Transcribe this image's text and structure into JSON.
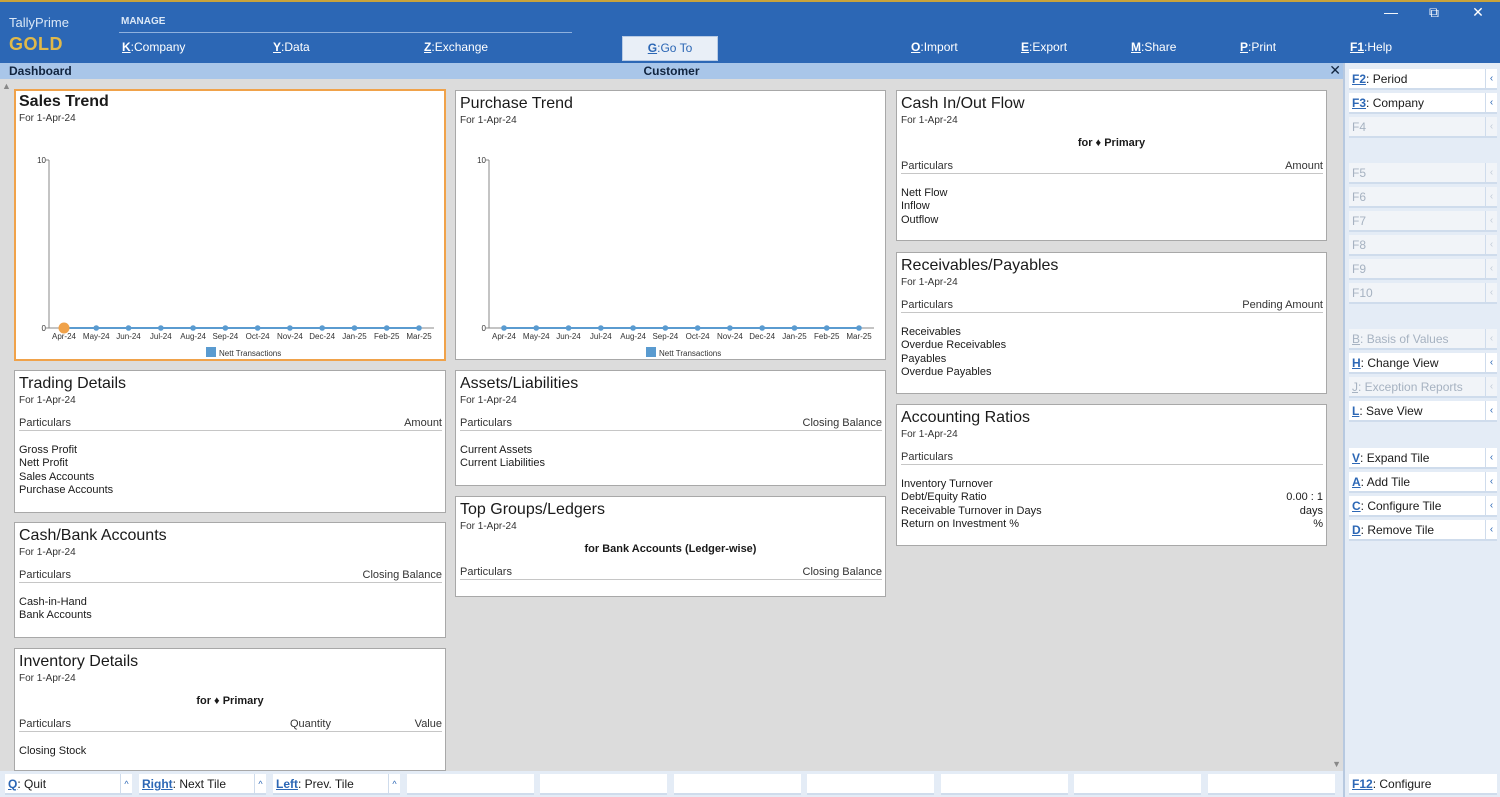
{
  "brand": {
    "name": "TallyPrime",
    "edition": "GOLD"
  },
  "menu": {
    "section": "MANAGE",
    "items": [
      {
        "key": "K",
        "label": "Company"
      },
      {
        "key": "Y",
        "label": "Data"
      },
      {
        "key": "Z",
        "label": "Exchange"
      },
      {
        "key": "G",
        "label": "Go To"
      },
      {
        "key": "O",
        "label": "Import"
      },
      {
        "key": "E",
        "label": "Export"
      },
      {
        "key": "M",
        "label": "Share"
      },
      {
        "key": "P",
        "label": "Print"
      },
      {
        "key": "F1",
        "label": "Help"
      }
    ]
  },
  "window_controls": {
    "minimize": "—",
    "restore": "⧉",
    "close": "✕"
  },
  "subheader": {
    "left": "Dashboard",
    "center": "Customer",
    "close": "✕"
  },
  "months": [
    "Apr-24",
    "May-24",
    "Jun-24",
    "Jul-24",
    "Aug-24",
    "Sep-24",
    "Oct-24",
    "Nov-24",
    "Dec-24",
    "Jan-25",
    "Feb-25",
    "Mar-25"
  ],
  "chart_data": [
    {
      "type": "line",
      "title": "Sales Trend",
      "subtitle": "For 1-Apr-24",
      "x": [
        "Apr-24",
        "May-24",
        "Jun-24",
        "Jul-24",
        "Aug-24",
        "Sep-24",
        "Oct-24",
        "Nov-24",
        "Dec-24",
        "Jan-25",
        "Feb-25",
        "Mar-25"
      ],
      "series": [
        {
          "name": "Nett Transactions",
          "values": [
            0,
            0,
            0,
            0,
            0,
            0,
            0,
            0,
            0,
            0,
            0,
            0
          ]
        }
      ],
      "ylim": [
        0,
        10
      ],
      "yticks": [
        "0",
        "10"
      ],
      "legend": "bottom",
      "highlight_index": 0,
      "colors": {
        "line": "#5a9bd0",
        "highlight": "#f0a24a"
      }
    },
    {
      "type": "line",
      "title": "Purchase Trend",
      "subtitle": "For 1-Apr-24",
      "x": [
        "Apr-24",
        "May-24",
        "Jun-24",
        "Jul-24",
        "Aug-24",
        "Sep-24",
        "Oct-24",
        "Nov-24",
        "Dec-24",
        "Jan-25",
        "Feb-25",
        "Mar-25"
      ],
      "series": [
        {
          "name": "Nett Transactions",
          "values": [
            0,
            0,
            0,
            0,
            0,
            0,
            0,
            0,
            0,
            0,
            0,
            0
          ]
        }
      ],
      "ylim": [
        0,
        10
      ],
      "yticks": [
        "0",
        "10"
      ],
      "legend": "bottom",
      "colors": {
        "line": "#5a9bd0"
      }
    }
  ],
  "tiles": {
    "cashflow": {
      "title": "Cash In/Out Flow",
      "sub": "For 1-Apr-24",
      "for": "for ♦ Primary",
      "col1": "Particulars",
      "col2": "Amount",
      "rows": [
        "Nett Flow",
        "Inflow",
        "Outflow"
      ]
    },
    "recpay": {
      "title": "Receivables/Payables",
      "sub": "For 1-Apr-24",
      "col1": "Particulars",
      "col2": "Pending Amount",
      "rows": [
        "Receivables",
        "Overdue Receivables",
        "Payables",
        "Overdue Payables"
      ]
    },
    "ratios": {
      "title": "Accounting Ratios",
      "sub": "For 1-Apr-24",
      "col1": "Particulars",
      "rows": [
        {
          "label": "Inventory Turnover",
          "value": ""
        },
        {
          "label": "Debt/Equity Ratio",
          "value": "0.00 : 1"
        },
        {
          "label": "Receivable Turnover in Days",
          "value": "days"
        },
        {
          "label": "Return on Investment %",
          "value": "%"
        }
      ]
    },
    "trading": {
      "title": "Trading Details",
      "sub": "For 1-Apr-24",
      "col1": "Particulars",
      "col2": "Amount",
      "rows": [
        "Gross Profit",
        "Nett Profit",
        "Sales Accounts",
        "Purchase Accounts"
      ]
    },
    "assets": {
      "title": "Assets/Liabilities",
      "sub": "For 1-Apr-24",
      "col1": "Particulars",
      "col2": "Closing Balance",
      "rows": [
        "Current Assets",
        "Current Liabilities"
      ]
    },
    "topgroups": {
      "title": "Top Groups/Ledgers",
      "sub": "For 1-Apr-24",
      "for": "for Bank Accounts (Ledger-wise)",
      "col1": "Particulars",
      "col2": "Closing Balance"
    },
    "cashbank": {
      "title": "Cash/Bank Accounts",
      "sub": "For 1-Apr-24",
      "col1": "Particulars",
      "col2": "Closing Balance",
      "rows": [
        "Cash-in-Hand",
        "Bank Accounts"
      ]
    },
    "inventory": {
      "title": "Inventory Details",
      "sub": "For 1-Apr-24",
      "for": "for ♦ Primary",
      "col1": "Particulars",
      "col2": "Quantity",
      "col3": "Value",
      "rows": [
        "Closing Stock"
      ]
    }
  },
  "right_panel": [
    {
      "key": "F2",
      "label": "Period",
      "enabled": true,
      "arrow": "‹"
    },
    {
      "key": "F3",
      "label": "Company",
      "enabled": true,
      "arrow": "‹"
    },
    {
      "key": "",
      "label": "F4",
      "enabled": false,
      "arrow": "‹"
    },
    {
      "key": "",
      "label": "F5",
      "enabled": false,
      "arrow": "‹"
    },
    {
      "key": "",
      "label": "F6",
      "enabled": false,
      "arrow": "‹"
    },
    {
      "key": "",
      "label": "F7",
      "enabled": false,
      "arrow": "‹"
    },
    {
      "key": "",
      "label": "F8",
      "enabled": false,
      "arrow": "‹"
    },
    {
      "key": "",
      "label": "F9",
      "enabled": false,
      "arrow": "‹"
    },
    {
      "key": "",
      "label": "F10",
      "enabled": false,
      "arrow": "‹"
    },
    {
      "key": "B",
      "label": "Basis of Values",
      "enabled": false,
      "arrow": "‹"
    },
    {
      "key": "H",
      "label": "Change View",
      "enabled": true,
      "arrow": "‹"
    },
    {
      "key": "J",
      "label": "Exception Reports",
      "enabled": false,
      "arrow": "‹"
    },
    {
      "key": "L",
      "label": "Save View",
      "enabled": true,
      "arrow": "‹"
    },
    {
      "key": "V",
      "label": "Expand Tile",
      "enabled": true,
      "arrow": "‹"
    },
    {
      "key": "A",
      "label": "Add Tile",
      "enabled": true,
      "arrow": "‹"
    },
    {
      "key": "C",
      "label": "Configure Tile",
      "enabled": true,
      "arrow": "‹"
    },
    {
      "key": "D",
      "label": "Remove Tile",
      "enabled": true,
      "arrow": "‹"
    }
  ],
  "bottom_bar": [
    {
      "key": "Q",
      "label": "Quit",
      "arrow": "^"
    },
    {
      "key": "Right",
      "label": "Next Tile",
      "arrow": "^"
    },
    {
      "key": "Left",
      "label": "Prev. Tile",
      "arrow": "^"
    }
  ],
  "configure": {
    "key": "F12",
    "label": "Configure"
  }
}
